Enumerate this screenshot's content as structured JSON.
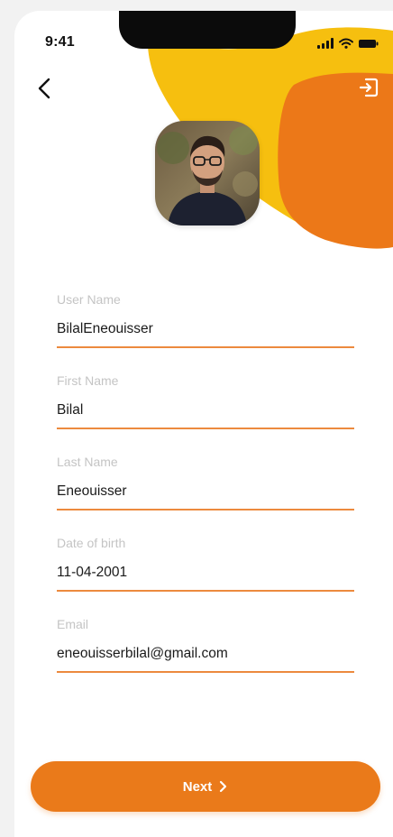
{
  "status_bar": {
    "time": "9:41",
    "icons": [
      "signal-icon",
      "wifi-icon",
      "battery-icon"
    ]
  },
  "header": {
    "back_icon": "chevron-left-icon",
    "logout_icon": "logout-icon"
  },
  "profile": {
    "avatar": "profile-photo"
  },
  "form": {
    "fields": [
      {
        "label": "User Name",
        "value": "BilalEneouisser"
      },
      {
        "label": "First Name",
        "value": "Bilal"
      },
      {
        "label": "Last Name",
        "value": "Eneouisser"
      },
      {
        "label": "Date of birth",
        "value": "11-04-2001"
      },
      {
        "label": "Email",
        "value": "eneouisserbilal@gmail.com"
      }
    ]
  },
  "actions": {
    "next_label": "Next",
    "next_icon": "chevron-right-icon"
  },
  "colors": {
    "accent": "#ea7a1a",
    "yellow": "#f6bf0f",
    "orange_blob": "#ec7818",
    "underline": "#ec8a3e",
    "label_gray": "#c4c4c4"
  }
}
